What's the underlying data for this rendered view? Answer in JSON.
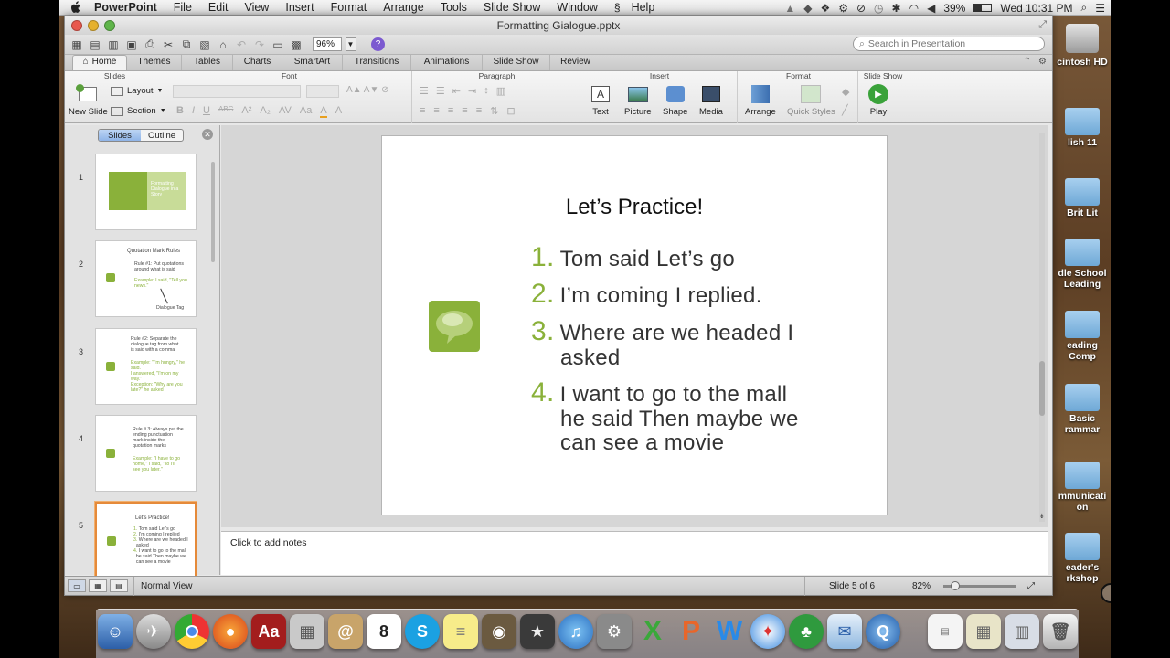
{
  "menubar": {
    "app": "PowerPoint",
    "items": [
      "File",
      "Edit",
      "View",
      "Insert",
      "Format",
      "Arrange",
      "Tools",
      "Slide Show",
      "Window",
      "Help"
    ],
    "battery": "39%",
    "clock": "Wed 10:31 PM"
  },
  "window": {
    "title": "Formatting Gialogue.pptx",
    "zoom": "96%",
    "search_placeholder": "Search in Presentation"
  },
  "tabs": [
    "Home",
    "Themes",
    "Tables",
    "Charts",
    "SmartArt",
    "Transitions",
    "Animations",
    "Slide Show",
    "Review"
  ],
  "ribbon": {
    "groups": {
      "slides": "Slides",
      "font": "Font",
      "paragraph": "Paragraph",
      "insert": "Insert",
      "format": "Format",
      "slideshow": "Slide Show"
    },
    "new_slide": "New Slide",
    "layout": "Layout",
    "section": "Section",
    "insert_buttons": [
      "Text",
      "Picture",
      "Shape",
      "Media"
    ],
    "arrange": "Arrange",
    "quick_styles": "Quick Styles",
    "play": "Play",
    "font_buttons": [
      "B",
      "I",
      "U",
      "ABC",
      "A"
    ]
  },
  "left_pane": {
    "seg": [
      "Slides",
      "Outline"
    ],
    "thumbs": [
      {
        "num": "1",
        "lines": [
          "Formatting",
          "Dialogue in a",
          "Story"
        ]
      },
      {
        "num": "2",
        "title": "Quotation Mark Rules",
        "lines": [
          "Rule #1: Put quotations",
          "around what is said"
        ],
        "green": [
          "Example: I said, \"Tell you",
          "news.\""
        ],
        "tag": "Dialogue Tag"
      },
      {
        "num": "3",
        "lines": [
          "Rule #2: Separate the",
          "dialogue tag from what",
          "is said with a comma"
        ],
        "green": [
          "Example: \"I'm hungry,\" he",
          "said.",
          "I answered, \"I'm on my",
          "way.\"",
          "Exception: \"Why are you",
          "late?\" he asked"
        ]
      },
      {
        "num": "4",
        "lines": [
          "Rule # 3: Always put the",
          "ending punctuation",
          "mark inside the",
          "quotation marks"
        ],
        "green": [
          "Example: \"I have to go",
          "home,\" I said, \"so I'll",
          "see you later.\""
        ]
      },
      {
        "num": "5",
        "title": "Let's Practice!",
        "lines": [
          "Tom said Let's go",
          "I'm coming I replied",
          "Where are we headed I",
          "asked",
          "I want to go to the mall",
          "he said Then maybe we",
          "can see a movie"
        ]
      }
    ]
  },
  "slide": {
    "title": "Let’s Practice!",
    "items": [
      {
        "num": "1.",
        "lines": [
          "Tom said Let’s go"
        ]
      },
      {
        "num": "2.",
        "lines": [
          "I’m coming I replied."
        ]
      },
      {
        "num": "3.",
        "lines": [
          "Where are we headed I",
          "asked"
        ]
      },
      {
        "num": "4.",
        "lines": [
          "I want to go to the mall",
          "he said Then maybe we",
          "can see a movie"
        ]
      }
    ],
    "accent_color": "#8ab13a"
  },
  "notes_placeholder": "Click to add notes",
  "status": {
    "view": "Normal View",
    "slide_of": "Slide 5 of 6",
    "zoom": "82%"
  },
  "desktop_icons": [
    "cintosh HD",
    "lish 11",
    "Brit Lit",
    "dle School",
    "Leading",
    "eading",
    "Comp",
    "Basic",
    "rammar",
    "mmunicati",
    "on",
    "eader's",
    "rkshop"
  ]
}
